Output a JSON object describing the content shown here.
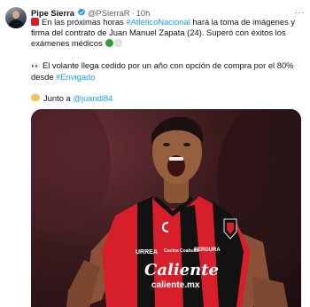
{
  "tweet": {
    "author": {
      "display_name": "Pipe Sierra",
      "handle": "@PSierraR",
      "time": "10h",
      "separator": "·",
      "more": "···"
    },
    "paragraph1": {
      "part1": "En las próximas horas ",
      "link1": "#AtléticoNacional",
      "part2": " hará la toma de imágenes y firma del contrato de Juan Manuel Zapata (24). Superó con éxitos los exámenes médicos"
    },
    "paragraph2": {
      "part1": "El volante llega cedido por un año con opción de compra por el 80% desde ",
      "link1": "#Envigado"
    },
    "paragraph3": {
      "part1": "Junto a ",
      "link1": "@juandl84"
    },
    "media": {
      "jersey_sponsor": "Caliente",
      "jersey_sponsor_url": "caliente.mx",
      "jersey_left_sponsor": "URREA",
      "jersey_right_sponsor": "PERDURA",
      "jersey_chest_mid": "Cocina Coahuila",
      "colors": {
        "red": "#d71f2b",
        "black": "#121212"
      }
    },
    "icons": [
      "verified-badge-icon",
      "rotating-light-icon",
      "green-circle-icon",
      "white-circle-icon",
      "eyes-icon",
      "handshake-icon",
      "more-icon"
    ],
    "colors": {
      "link": "#1d9bf0",
      "secondary_text": "#536471",
      "verified": "#1d9bf0"
    }
  }
}
